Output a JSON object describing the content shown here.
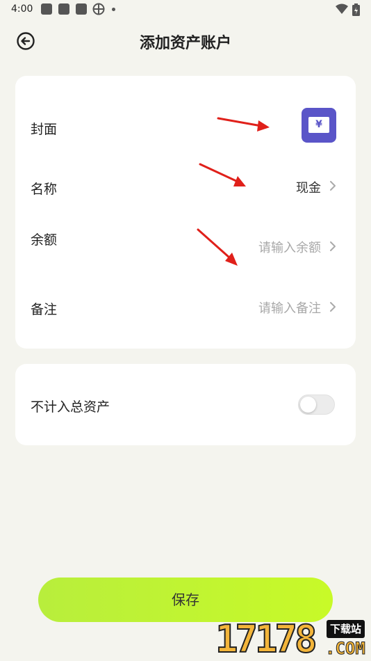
{
  "status_bar": {
    "time": "4:00",
    "icons": [
      "app-icon",
      "app-icon",
      "app-icon",
      "clover-icon",
      "dot-icon",
      "wifi-icon",
      "battery-icon"
    ]
  },
  "header": {
    "back_icon": "back-circle-icon",
    "title": "添加资产账户"
  },
  "form": {
    "cover": {
      "label": "封面",
      "icon": "money-bill-icon",
      "icon_glyph": "¥",
      "icon_color": "#5a55c8"
    },
    "name": {
      "label": "名称",
      "value": "现金"
    },
    "balance": {
      "label": "余额",
      "placeholder": "请输入余额"
    },
    "note": {
      "label": "备注",
      "placeholder": "请输入备注"
    }
  },
  "settings": {
    "exclude_total": {
      "label": "不计入总资产",
      "enabled": false
    }
  },
  "actions": {
    "save_label": "保存",
    "save_color": "#c3f52f"
  },
  "watermark": {
    "number": "17178",
    "tag": "下载站",
    "domain": ".COM"
  },
  "colors": {
    "background": "#f4f4ee",
    "card": "#ffffff",
    "annotation_arrow": "#e0201a"
  }
}
